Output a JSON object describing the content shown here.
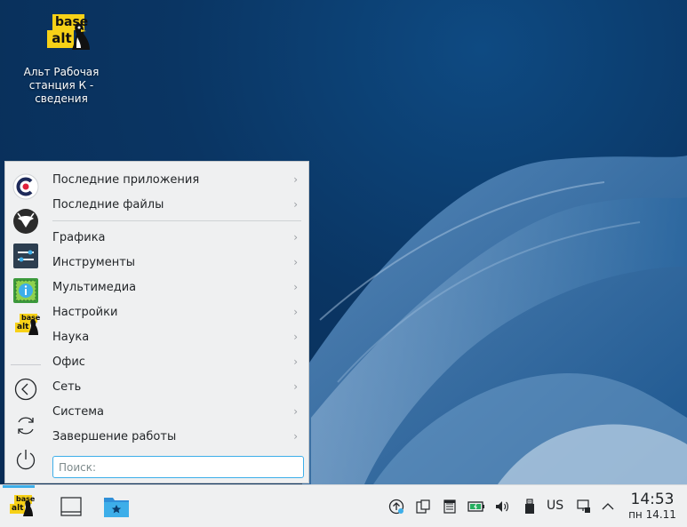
{
  "desktop": {
    "icon": {
      "logo_top": "base",
      "logo_bottom": "alt",
      "caption": "Альт Рабочая\nстанция К  -\nсведения"
    }
  },
  "menu": {
    "favorites": [
      {
        "icon": "calamares-icon"
      },
      {
        "icon": "browser-icon"
      },
      {
        "icon": "settings-sliders-icon"
      },
      {
        "icon": "system-info-icon"
      },
      {
        "icon": "basealt-icon"
      },
      {
        "icon": "back-arrow-icon"
      },
      {
        "icon": "refresh-icon"
      },
      {
        "icon": "power-icon"
      }
    ],
    "recent": [
      {
        "label": "Последние приложения"
      },
      {
        "label": "Последние файлы"
      }
    ],
    "categories": [
      {
        "label": "Графика"
      },
      {
        "label": "Инструменты"
      },
      {
        "label": "Мультимедиа"
      },
      {
        "label": "Настройки"
      },
      {
        "label": "Наука"
      },
      {
        "label": "Офис"
      },
      {
        "label": "Сеть"
      },
      {
        "label": "Система"
      },
      {
        "label": "Завершение работы"
      }
    ],
    "arrow": "›",
    "search_placeholder": "Поиск:"
  },
  "panel": {
    "launcher_logo_top": "base",
    "launcher_logo_bottom": "alt",
    "keyboard_layout": "US",
    "clock": {
      "time": "14:53",
      "date": "пн 14.11"
    },
    "accent": "#3daee9"
  }
}
